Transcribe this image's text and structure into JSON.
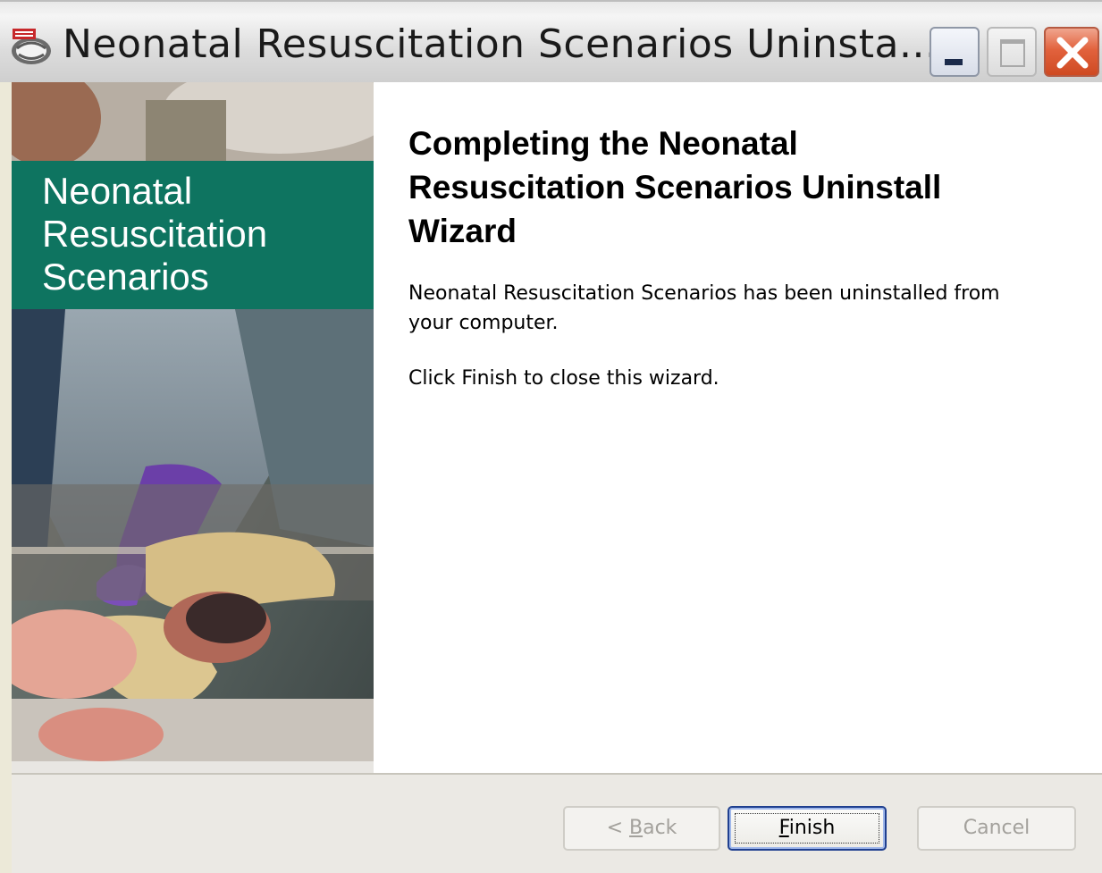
{
  "window": {
    "title": "Neonatal Resuscitation Scenarios Uninsta...",
    "icon": "app-logo-icon"
  },
  "title_buttons": {
    "minimize": "minimize-icon",
    "maximize": "maximize-icon",
    "close": "close-icon"
  },
  "side_panel": {
    "brand_lines": [
      "Neonatal",
      "Resuscitation",
      "Scenarios"
    ],
    "band_color": "#0e7460"
  },
  "content": {
    "heading_lines": [
      "Completing the Neonatal",
      "Resuscitation Scenarios Uninstall",
      "Wizard"
    ],
    "message_lines": [
      "Neonatal Resuscitation Scenarios has been uninstalled from",
      "your computer."
    ],
    "instruction": "Click Finish to close this wizard."
  },
  "buttons": {
    "back_prefix": "< ",
    "back_mnemonic": "B",
    "back_rest": "ack",
    "finish_mnemonic": "F",
    "finish_rest": "inish",
    "cancel": "Cancel"
  }
}
